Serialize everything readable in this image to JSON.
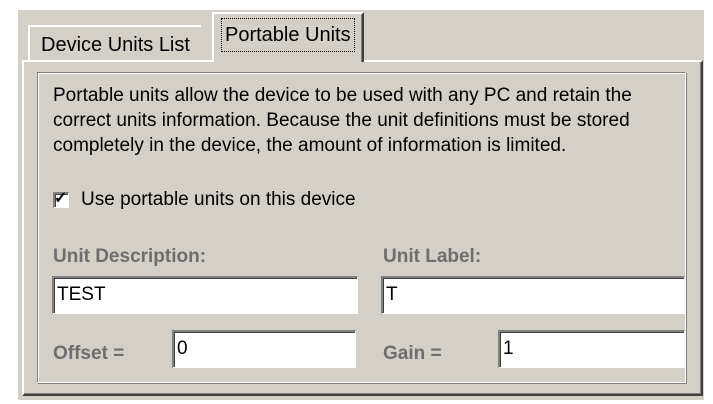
{
  "tabs": [
    {
      "label": "Device Units List",
      "active": false
    },
    {
      "label": "Portable Units",
      "active": true
    }
  ],
  "panel": {
    "description": "Portable units allow the device to be used with any PC and retain the correct units information. Because the unit definitions must be stored completely in the device, the amount of information is limited.",
    "portable_checkbox": {
      "label": "Use portable units on this device",
      "checked": true,
      "glyph": "✓"
    },
    "unit_description": {
      "label": "Unit Description:",
      "value": "TEST"
    },
    "unit_label": {
      "label": "Unit Label:",
      "value": "T"
    },
    "offset": {
      "label": "Offset =",
      "value": "0"
    },
    "gain": {
      "label": "Gain =",
      "value": "1"
    }
  },
  "colors": {
    "dialog_face": "#d4d0c8",
    "field_label_text": "#6e6e6e"
  }
}
